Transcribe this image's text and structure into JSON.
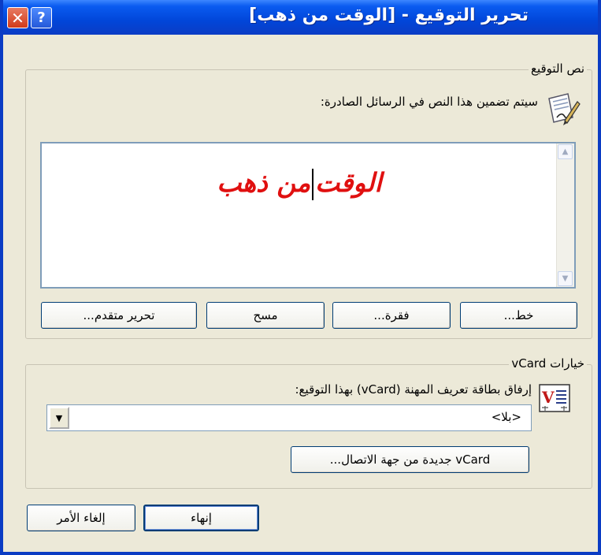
{
  "window": {
    "title": "تحرير التوقيع - [الوقت من ذهب]",
    "help_glyph": "?",
    "close_glyph": "✕"
  },
  "signature_group": {
    "label": "نص التوقيع",
    "description": "سيتم تضمين هذا النص في الرسائل الصادرة:",
    "icon": "signature-pen-icon",
    "editor_text_part1": "الوقت",
    "editor_text_part2": "من ذهب",
    "text_color": "#e01010"
  },
  "format_buttons": {
    "font": "خط...",
    "paragraph": "فقرة...",
    "clear": "مسح",
    "advanced_edit": "تحرير متقدم..."
  },
  "vcard_group": {
    "label": "خيارات vCard",
    "attach_label": "إرفاق بطاقة تعريف المهنة (vCard) بهذا التوقيع:",
    "icon": "vcard-icon",
    "icon_letter": "V",
    "selected_value": "<بلا>",
    "new_vcard_button": "vCard جديدة من جهة الاتصال..."
  },
  "footer": {
    "finish": "إنهاء",
    "cancel": "إلغاء الأمر"
  }
}
